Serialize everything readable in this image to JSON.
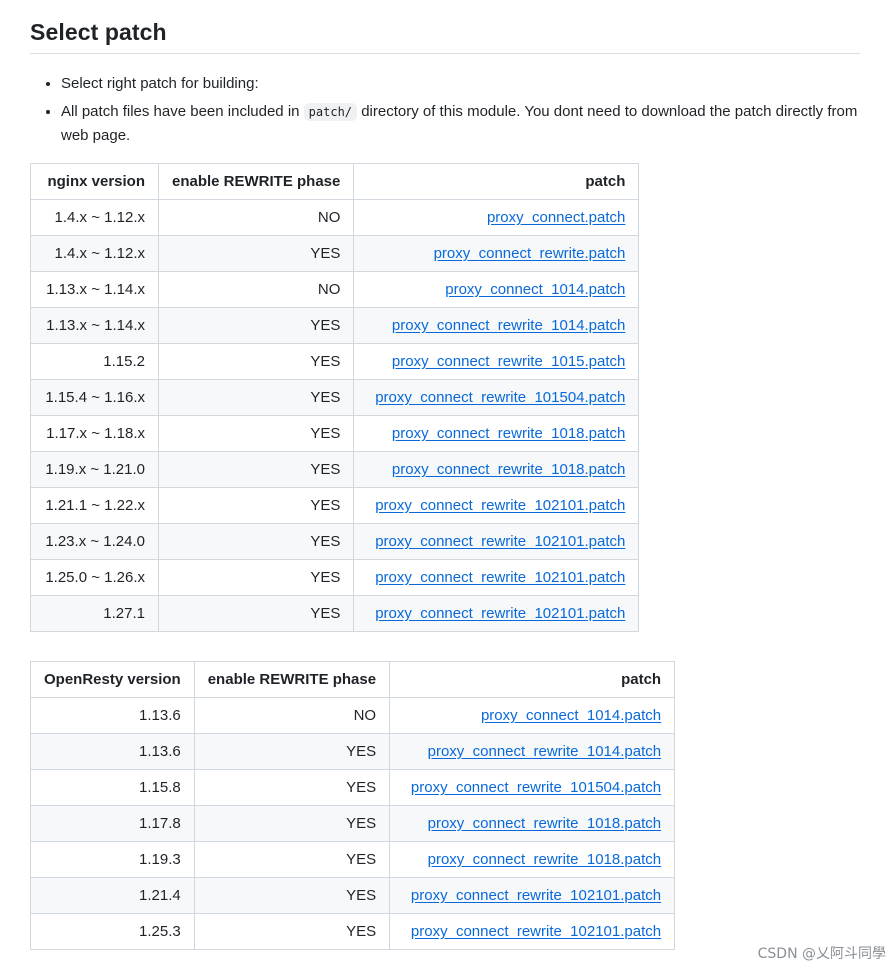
{
  "section": {
    "title": "Select patch"
  },
  "notes": {
    "item1": "Select right patch for building:",
    "item2_before": "All patch files have been included in ",
    "item2_code": "patch/",
    "item2_after": " directory of this module. You dont need to download the patch directly from web page."
  },
  "nginx_table": {
    "headers": [
      "nginx version",
      "enable REWRITE phase",
      "patch"
    ],
    "rows": [
      [
        "1.4.x ~ 1.12.x",
        "NO",
        "proxy_connect.patch"
      ],
      [
        "1.4.x ~ 1.12.x",
        "YES",
        "proxy_connect_rewrite.patch"
      ],
      [
        "1.13.x ~ 1.14.x",
        "NO",
        "proxy_connect_1014.patch"
      ],
      [
        "1.13.x ~ 1.14.x",
        "YES",
        "proxy_connect_rewrite_1014.patch"
      ],
      [
        "1.15.2",
        "YES",
        "proxy_connect_rewrite_1015.patch"
      ],
      [
        "1.15.4 ~ 1.16.x",
        "YES",
        "proxy_connect_rewrite_101504.patch"
      ],
      [
        "1.17.x ~ 1.18.x",
        "YES",
        "proxy_connect_rewrite_1018.patch"
      ],
      [
        "1.19.x ~ 1.21.0",
        "YES",
        "proxy_connect_rewrite_1018.patch"
      ],
      [
        "1.21.1 ~ 1.22.x",
        "YES",
        "proxy_connect_rewrite_102101.patch"
      ],
      [
        "1.23.x ~ 1.24.0",
        "YES",
        "proxy_connect_rewrite_102101.patch"
      ],
      [
        "1.25.0 ~ 1.26.x",
        "YES",
        "proxy_connect_rewrite_102101.patch"
      ],
      [
        "1.27.1",
        "YES",
        "proxy_connect_rewrite_102101.patch"
      ]
    ]
  },
  "openresty_table": {
    "headers": [
      "OpenResty version",
      "enable REWRITE phase",
      "patch"
    ],
    "rows": [
      [
        "1.13.6",
        "NO",
        "proxy_connect_1014.patch"
      ],
      [
        "1.13.6",
        "YES",
        "proxy_connect_rewrite_1014.patch"
      ],
      [
        "1.15.8",
        "YES",
        "proxy_connect_rewrite_101504.patch"
      ],
      [
        "1.17.8",
        "YES",
        "proxy_connect_rewrite_1018.patch"
      ],
      [
        "1.19.3",
        "YES",
        "proxy_connect_rewrite_1018.patch"
      ],
      [
        "1.21.4",
        "YES",
        "proxy_connect_rewrite_102101.patch"
      ],
      [
        "1.25.3",
        "YES",
        "proxy_connect_rewrite_102101.patch"
      ]
    ]
  },
  "watermark": "CSDN @乂阿斗同學",
  "colors": {
    "link": "#0969da",
    "border": "#d0d7de",
    "stripe": "#f6f8fa",
    "text": "#1f2328"
  }
}
